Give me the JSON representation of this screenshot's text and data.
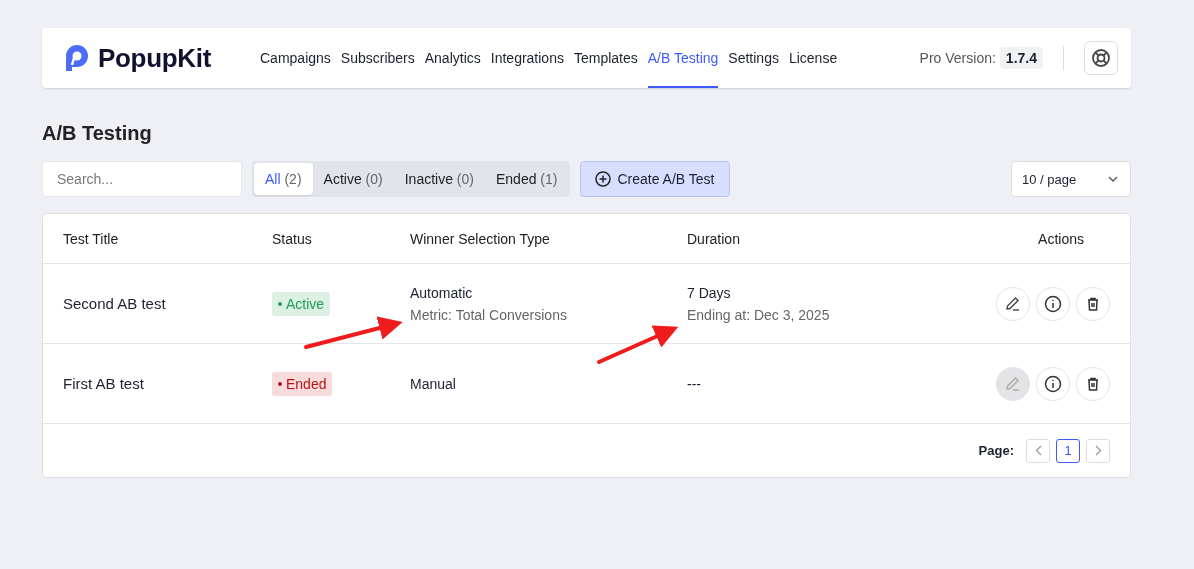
{
  "header": {
    "brand": "PopupKit",
    "nav": [
      {
        "label": "Campaigns",
        "selected": false
      },
      {
        "label": "Subscribers",
        "selected": false
      },
      {
        "label": "Analytics",
        "selected": false
      },
      {
        "label": "Integrations",
        "selected": false
      },
      {
        "label": "Templates",
        "selected": false
      },
      {
        "label": "A/B Testing",
        "selected": true
      },
      {
        "label": "Settings",
        "selected": false
      },
      {
        "label": "License",
        "selected": false
      }
    ],
    "version_label": "Pro Version:",
    "version": "1.7.4"
  },
  "page_title": "A/B Testing",
  "search": {
    "placeholder": "Search..."
  },
  "filters": [
    {
      "label": "All",
      "count": "(2)",
      "selected": true
    },
    {
      "label": "Active",
      "count": "(0)",
      "selected": false
    },
    {
      "label": "Inactive",
      "count": "(0)",
      "selected": false
    },
    {
      "label": "Ended",
      "count": "(1)",
      "selected": false
    }
  ],
  "create_button": "Create A/B Test",
  "page_size": "10 / page",
  "table": {
    "columns": [
      "Test Title",
      "Status",
      "Winner Selection Type",
      "Duration",
      "Actions"
    ],
    "rows": [
      {
        "title": "Second AB test",
        "status": {
          "kind": "active",
          "label": "Active"
        },
        "winner": "Automatic",
        "winner_detail": "Metric: Total Conversions",
        "duration": "7 Days",
        "duration_detail": "Ending at: Dec 3, 2025",
        "edit_disabled": false
      },
      {
        "title": "First AB test",
        "status": {
          "kind": "ended",
          "label": "Ended"
        },
        "winner": "Manual",
        "duration": "---",
        "edit_disabled": true
      }
    ]
  },
  "pagination": {
    "label": "Page:",
    "pages": [
      {
        "label": "1",
        "selected": true
      }
    ]
  }
}
